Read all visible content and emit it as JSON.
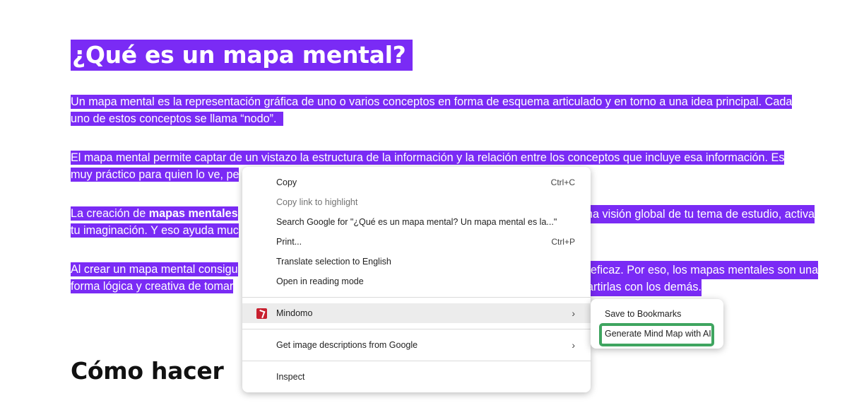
{
  "article": {
    "title": "¿Qué es un mapa mental?",
    "p1_line1": "Un mapa mental es la representación gráfica de uno o varios conceptos en forma de esquema articulado y en torno a una idea principal. Cada",
    "p1_line2": "uno de estos conceptos se llama “nodo”.",
    "p2_line1": "El mapa mental permite captar de un vistazo la estructura de la información y la relación entre los conceptos que incluye esa información. Es",
    "p2_line2": "muy práctico para quien lo ve, pe",
    "p3_line1_a": "La creación de ",
    "p3_line1_bold": "mapas mentales",
    "p3_line1_b": "na visión global de tu tema de estudio, activa",
    "p3_line2": "tu imaginación. Y eso ayuda muc",
    "p4_line1_a": "Al crear un mapa mental consigu",
    "p4_line1_b": "eficaz. Por eso, los mapas mentales son una",
    "p4_line2_a": "forma lógica y creativa de tomar",
    "p4_line2_b": "partirlas con los demás.",
    "h2": "Cómo hacer"
  },
  "context_menu": {
    "items": [
      {
        "label": "Copy",
        "shortcut": "Ctrl+C"
      },
      {
        "label": "Copy link to highlight",
        "shortcut": ""
      },
      {
        "label": "Search Google for \"¿Qué es un mapa mental? Un mapa mental es la...\"",
        "shortcut": ""
      },
      {
        "label": "Print...",
        "shortcut": "Ctrl+P"
      },
      {
        "label": "Translate selection to English",
        "shortcut": ""
      },
      {
        "label": "Open in reading mode",
        "shortcut": ""
      }
    ],
    "mindomo": "Mindomo",
    "image_desc": "Get image descriptions from Google",
    "inspect": "Inspect",
    "arrow": "›"
  },
  "submenu": {
    "save": "Save to Bookmarks",
    "generate": "Generate Mind Map with AI"
  },
  "colors": {
    "selection": "#7a2bf5",
    "highlight_box": "#3fa560"
  }
}
